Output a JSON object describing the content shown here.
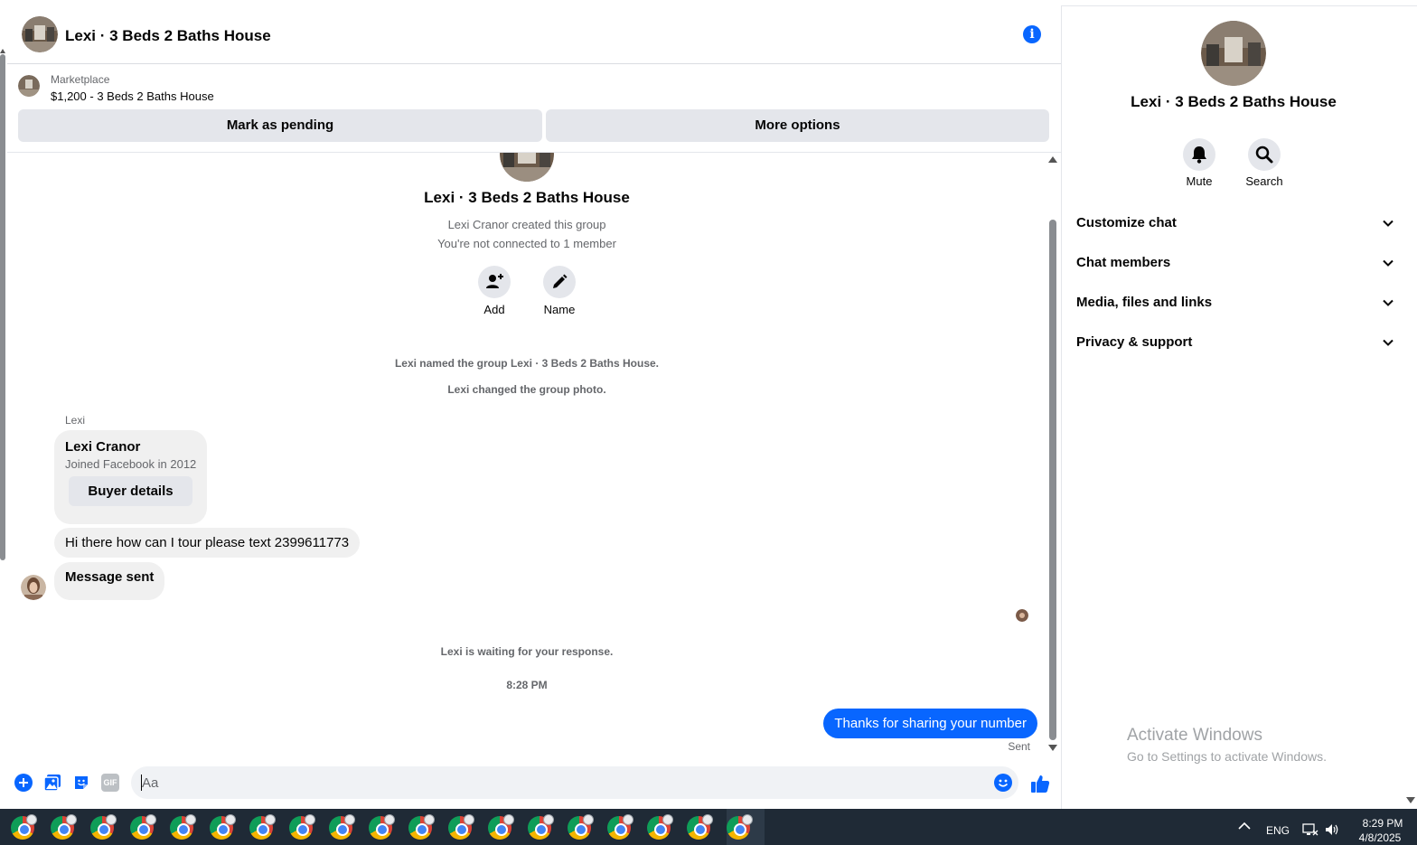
{
  "header": {
    "title": "Lexi · 3 Beds 2 Baths House",
    "info_icon": "info-icon"
  },
  "marketplace": {
    "label": "Marketplace",
    "listing": "$1,200 - 3 Beds 2 Baths House",
    "pending_button": "Mark as pending",
    "more_button": "More options"
  },
  "thread": {
    "group_title": "Lexi · 3 Beds 2 Baths House",
    "created_line": "Lexi Cranor created this group",
    "connected_line": "You're not connected to 1 member",
    "add_label": "Add",
    "name_label": "Name",
    "named_event": "Lexi named the group Lexi · 3 Beds 2 Baths House.",
    "photo_event": "Lexi changed the group photo.",
    "sender": "Lexi",
    "card": {
      "name": "Lexi Cranor",
      "joined": "Joined Facebook in 2012",
      "button": "Buyer details"
    },
    "incoming": [
      "Hi there how can I tour please text 2399611773",
      "Message sent"
    ],
    "waiting": "Lexi is waiting for your response.",
    "timestamp": "8:28 PM",
    "outgoing": "Thanks for sharing your number",
    "status": "Sent"
  },
  "composer": {
    "placeholder": "Aa",
    "gif_label": "GIF"
  },
  "side_panel": {
    "title": "Lexi · 3 Beds 2 Baths House",
    "mute": "Mute",
    "search": "Search",
    "sections": [
      "Customize chat",
      "Chat members",
      "Media, files and links",
      "Privacy & support"
    ]
  },
  "watermark": {
    "line1": "Activate Windows",
    "line2": "Go to Settings to activate Windows."
  },
  "taskbar": {
    "language": "ENG",
    "time": "8:29 PM",
    "date": "4/8/2025"
  },
  "colors": {
    "accent": "#0866ff",
    "bubble_in": "#f0f0f0",
    "button_bg": "#e4e6eb",
    "taskbar": "#1f2a36"
  }
}
